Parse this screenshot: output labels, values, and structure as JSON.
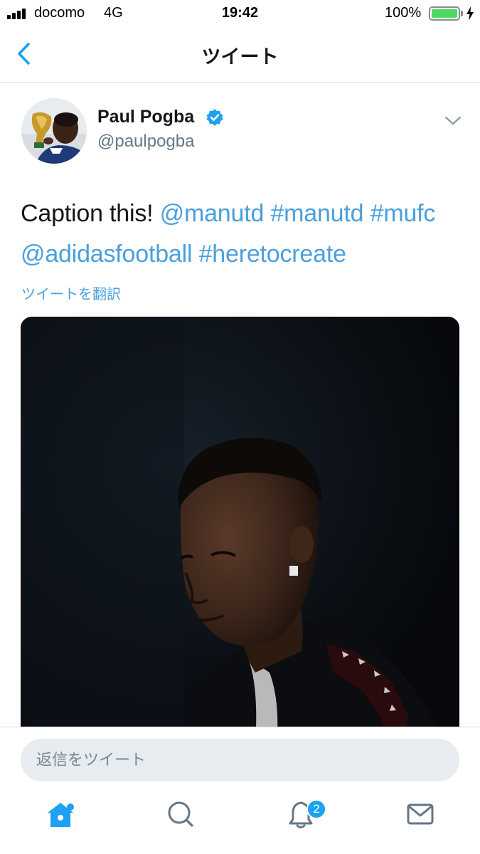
{
  "status_bar": {
    "carrier": "docomo",
    "network": "4G",
    "time": "19:42",
    "battery_percent": "100%",
    "battery_level": 1.0,
    "battery_color": "#4cd964"
  },
  "nav": {
    "title": "ツイート",
    "accent_color": "#1da1f2"
  },
  "tweet": {
    "display_name": "Paul Pogba",
    "handle": "@paulpogba",
    "verified": true,
    "text_plain": "Caption this!",
    "text_links": [
      "@manutd",
      "#manutd",
      "#mufc",
      "@adidasfootball",
      "#heretocreate"
    ],
    "translate_label": "ツイートを翻訳",
    "link_color": "#4a9fdc"
  },
  "reply": {
    "placeholder": "返信をツイート"
  },
  "tab_bar": {
    "items": [
      {
        "name": "home",
        "icon": "home-icon",
        "active": true
      },
      {
        "name": "search",
        "icon": "search-icon",
        "active": false
      },
      {
        "name": "notifications",
        "icon": "bell-icon",
        "active": false,
        "badge": "2"
      },
      {
        "name": "messages",
        "icon": "mail-icon",
        "active": false
      }
    ]
  }
}
